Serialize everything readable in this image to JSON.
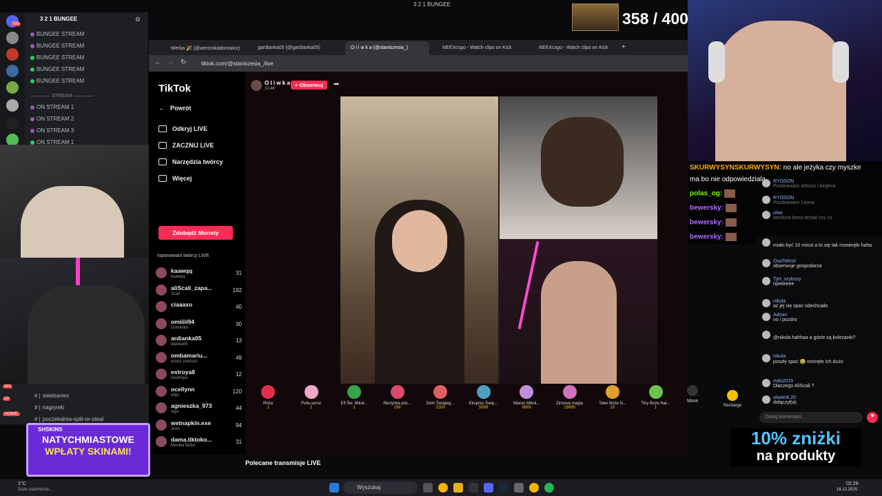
{
  "window_title": "3 2 1 BUNGEE",
  "counter": "358 / 400",
  "discord": {
    "server": "3 2 1 BUNGEE",
    "channels": [
      "BUNGEE STREAM",
      "BUNGEE STREAM",
      "BUNGEE STREAM",
      "BUNGEE STREAM",
      "BUNGEE STREAM"
    ],
    "section": "STREAM",
    "streams": [
      "ON STREAM 1",
      "ON STREAM 2",
      "ON STREAM 3",
      "ON STREAM 1"
    ],
    "badges": [
      "593",
      "1",
      "17",
      "7",
      "1",
      "16"
    ],
    "text_channels": [
      "steelseries",
      "nagrywki",
      "poczekalnia-split-or-steal"
    ],
    "side_badges": [
      "381",
      "10",
      "20",
      "NOWE"
    ]
  },
  "browser": {
    "tabs": [
      "Werka 🎉 (@weronikadorowicz)",
      "gardianka05 (@gardianka05)",
      "O l i w k a (@staniszesia_)",
      "NEEXcsgo - Watch clips on Kick",
      "NEEXcsgo - Watch clips on Kick"
    ],
    "url": "tiktok.com/@staniszesia_/live"
  },
  "tiktok": {
    "logo": "TikTok",
    "nav": [
      "Powrót",
      "Odkryj LIVE",
      "ZACZNIJ LIVE",
      "Narzędzia twórcy",
      "Więcej"
    ],
    "coins_button": "Zdobądź Monety",
    "creators_header": "roponowani twórcy LIVE",
    "creators": [
      {
        "name": "kaawqq",
        "sub": "kaawqq",
        "count": "31"
      },
      {
        "name": "aliScali_zapa...",
        "sub": "Scali",
        "count": "192"
      },
      {
        "name": "ciaaaxo",
        "sub": "",
        "count": "40"
      },
      {
        "name": "omiiiii94",
        "sub": "Dominika",
        "count": "30"
      },
      {
        "name": "ardianka05",
        "sub": "dianka05",
        "count": "13"
      },
      {
        "name": "ombamariu...",
        "sub": "ariusz mariusz",
        "count": "49"
      },
      {
        "name": "estroya8",
        "sub": "Destroya",
        "count": "12"
      },
      {
        "name": "ocellynn",
        "sub": "ellyn",
        "count": "120"
      },
      {
        "name": "agnieszka_973",
        "sub": "Aga",
        "count": "44"
      },
      {
        "name": "wetnapkin.exe",
        "sub": "Josh",
        "count": "94"
      },
      {
        "name": "dama.tiktoko...",
        "sub": "Monika Bubu",
        "count": "31"
      }
    ],
    "host": {
      "name": "O l i w k a",
      "followers": "10.4K",
      "follow_button": "+ Obserwuj"
    },
    "gifts": [
      {
        "name": "Róża",
        "price": "1",
        "color": "#e0304a"
      },
      {
        "name": "Pufa-serce",
        "price": "1",
        "color": "#f3a6c8"
      },
      {
        "name": "Elf Św. Mikoł...",
        "price": "1",
        "color": "#3aa14a"
      },
      {
        "name": "Skrzynka poc...",
        "price": "199",
        "color": "#d84a6a"
      },
      {
        "name": "Dom Świąteg...",
        "price": "2200",
        "color": "#e06060"
      },
      {
        "name": "Ekspres Świę...",
        "price": "5999",
        "color": "#4aa0c0"
      },
      {
        "name": "Miasto Mikoł...",
        "price": "9999",
        "color": "#c090e0"
      },
      {
        "name": "Zimowa magia",
        "price": "19999",
        "color": "#d070c0"
      },
      {
        "name": "Tater Boże N...",
        "price": "10",
        "color": "#e0a030"
      },
      {
        "name": "Tiny Boże Nar...",
        "price": "1",
        "color": "#70c050"
      }
    ],
    "more": "More",
    "recharge": "Recharge",
    "recommended": "Polecane transmisje LIVE",
    "comment_placeholder": "Dodaj komentarz..."
  },
  "stream_chat": [
    {
      "user": "SKURWYSYNSKURWYSYN:",
      "text": "no ale jeżyka czy myszke",
      "color": "#ffb000"
    },
    {
      "user": "",
      "text": "ma bo nie odpowiedziala",
      "color": "#ffffff"
    },
    {
      "user": "polas_og:",
      "text": "",
      "color": "#7cfc00"
    },
    {
      "user": "bewersky:",
      "text": "",
      "color": "#b36bff"
    },
    {
      "user": "bewersky:",
      "text": "",
      "color": "#b36bff"
    },
    {
      "user": "bewersky:",
      "text": "",
      "color": "#b36bff"
    }
  ],
  "live_comments": [
    {
      "user": "RYOSON",
      "text": "Pozdrawiam arbuza i birglera"
    },
    {
      "user": "RYOSON",
      "text": "Pozdrawiam Leona"
    },
    {
      "user": "oliwi",
      "text": "bandura bana dostał czy co"
    },
    {
      "user": "",
      "text": "miało być 10 minut a to się tak rozwinęło haha"
    },
    {
      "user": "OsaToKrol",
      "text": "obserwuje gospodarza"
    },
    {
      "user": "Tjet_szybszy",
      "text": "njieeeeee"
    },
    {
      "user": "nikola",
      "text": "aż jej się spać odechciało"
    },
    {
      "user": "Adrian",
      "text": "no i pozdro"
    },
    {
      "user": "",
      "text": "@nikola hahhaa a gdzie są koleżanki?"
    },
    {
      "user": "nikola",
      "text": "poszły spać 😂 ominęło ich dużo"
    },
    {
      "user": "mdo2015",
      "text": "Dlaczego AliScali ?"
    },
    {
      "user": "oliwierk.20",
      "text": "dołączył(a)"
    }
  ],
  "promo": {
    "line1": "10% zniżki",
    "line2": "na produkty"
  },
  "banner": {
    "brand": "SHSKINS",
    "line1": "NATYCHMIASTOWE",
    "line2": "WPŁATY SKINAMI!"
  },
  "taskbar": {
    "weather_temp": "1°C",
    "weather_desc": "Duże zachmurze...",
    "search": "Wyszukaj",
    "time": "02:29",
    "date": "18.12.2025"
  }
}
